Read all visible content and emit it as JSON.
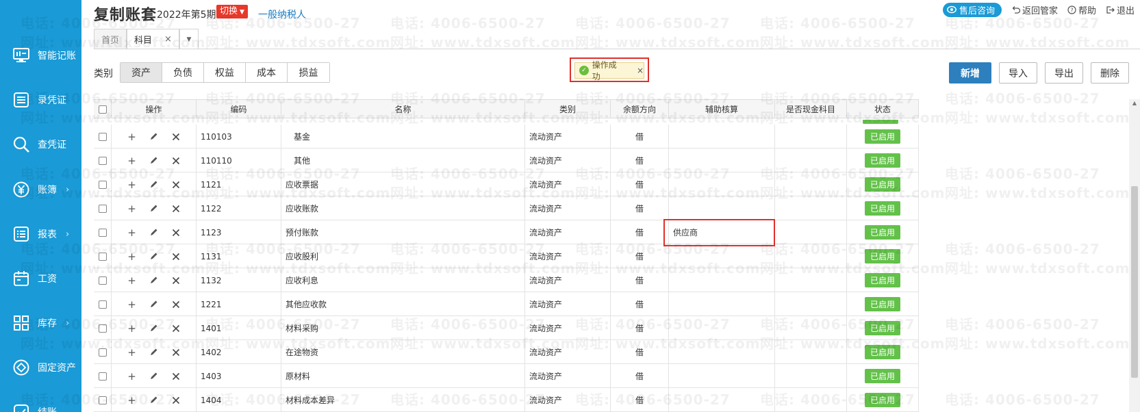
{
  "sidebar": {
    "items": [
      {
        "label": "智能记账",
        "icon": "monitor-icon",
        "arrow": ""
      },
      {
        "label": "录凭证",
        "icon": "document-icon",
        "arrow": ""
      },
      {
        "label": "查凭证",
        "icon": "search-icon",
        "arrow": ""
      },
      {
        "label": "账簿",
        "icon": "yen-icon",
        "arrow": "›"
      },
      {
        "label": "报表",
        "icon": "list-icon",
        "arrow": "›"
      },
      {
        "label": "工资",
        "icon": "calendar-icon",
        "arrow": ""
      },
      {
        "label": "库存",
        "icon": "grid-icon",
        "arrow": "›"
      },
      {
        "label": "固定资产",
        "icon": "diamond-icon",
        "arrow": ""
      },
      {
        "label": "结账",
        "icon": "check-icon",
        "arrow": ""
      }
    ]
  },
  "header": {
    "title": "复制账套",
    "period": "2022年第5期",
    "switch_label": "切换",
    "taxpayer": "一般纳税人",
    "consult": "售后咨询",
    "back": "返回管家",
    "help": "帮助",
    "logout": "退出"
  },
  "tabs": {
    "home": "首页",
    "active": "科目",
    "close": "×"
  },
  "category": {
    "label": "类别",
    "options": [
      "资产",
      "负债",
      "权益",
      "成本",
      "损益"
    ]
  },
  "toast": {
    "message": "操作成功",
    "close": "×"
  },
  "actions": {
    "add": "新增",
    "import": "导入",
    "export": "导出",
    "delete": "删除"
  },
  "table": {
    "columns": [
      "操作",
      "编码",
      "名称",
      "类别",
      "余额方向",
      "辅助核算",
      "是否现金科目",
      "状态"
    ],
    "rows": [
      {
        "code": "110103",
        "name": "　基金",
        "type": "流动资产",
        "direction": "借",
        "aux": "",
        "cash": "",
        "status": "已启用"
      },
      {
        "code": "110110",
        "name": "　其他",
        "type": "流动资产",
        "direction": "借",
        "aux": "",
        "cash": "",
        "status": "已启用"
      },
      {
        "code": "1121",
        "name": "应收票据",
        "type": "流动资产",
        "direction": "借",
        "aux": "",
        "cash": "",
        "status": "已启用"
      },
      {
        "code": "1122",
        "name": "应收账款",
        "type": "流动资产",
        "direction": "借",
        "aux": "",
        "cash": "",
        "status": "已启用"
      },
      {
        "code": "1123",
        "name": "预付账款",
        "type": "流动资产",
        "direction": "借",
        "aux": "供应商",
        "cash": "",
        "status": "已启用"
      },
      {
        "code": "1131",
        "name": "应收股利",
        "type": "流动资产",
        "direction": "借",
        "aux": "",
        "cash": "",
        "status": "已启用"
      },
      {
        "code": "1132",
        "name": "应收利息",
        "type": "流动资产",
        "direction": "借",
        "aux": "",
        "cash": "",
        "status": "已启用"
      },
      {
        "code": "1221",
        "name": "其他应收款",
        "type": "流动资产",
        "direction": "借",
        "aux": "",
        "cash": "",
        "status": "已启用"
      },
      {
        "code": "1401",
        "name": "材料采购",
        "type": "流动资产",
        "direction": "借",
        "aux": "",
        "cash": "",
        "status": "已启用"
      },
      {
        "code": "1402",
        "name": "在途物资",
        "type": "流动资产",
        "direction": "借",
        "aux": "",
        "cash": "",
        "status": "已启用"
      },
      {
        "code": "1403",
        "name": "原材料",
        "type": "流动资产",
        "direction": "借",
        "aux": "",
        "cash": "",
        "status": "已启用"
      },
      {
        "code": "1404",
        "name": "材料成本差异",
        "type": "流动资产",
        "direction": "借",
        "aux": "",
        "cash": "",
        "status": "已启用"
      }
    ]
  },
  "watermark": {
    "phone": "电话: 4006-6500-27",
    "site": "网址: www.tdxsoft.com"
  },
  "colors": {
    "sidebar": "#1a9ad6",
    "primary": "#2d7fbd",
    "status_green": "#63c14a",
    "highlight_red": "#e0302a",
    "switch_red": "#e6392b"
  }
}
